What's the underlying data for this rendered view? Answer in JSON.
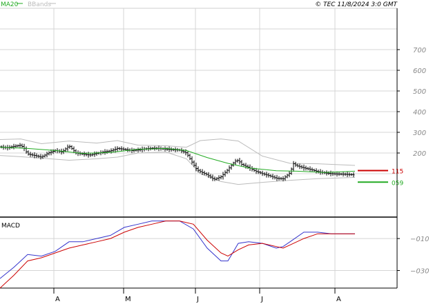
{
  "header": {
    "legend_ma": "MA20",
    "legend_bb": "BBands",
    "copyright": "© TEC 11/8/2024 3:0 GMT"
  },
  "colors": {
    "ma": "#22aa22",
    "bbands": "#bbbbbb",
    "candle": "#000000",
    "grid": "#d4d4d4",
    "axis": "#000000",
    "right_ticks": "#555555",
    "marker_red": "#cc0000",
    "marker_green": "#22aa22",
    "macd": "#3333cc",
    "signal": "#cc0000",
    "label_text": "#888888"
  },
  "price_panel": {
    "ylim": [
      -110,
      900
    ],
    "yticks": [
      {
        "value": 700,
        "label": "700"
      },
      {
        "value": 600,
        "label": "600"
      },
      {
        "value": 500,
        "label": "500"
      },
      {
        "value": 400,
        "label": "400"
      },
      {
        "value": 300,
        "label": "300"
      },
      {
        "value": 200,
        "label": "200"
      }
    ],
    "markers": [
      {
        "value": 115,
        "label": "115",
        "color": "#cc0000"
      },
      {
        "value": 59,
        "label": "059",
        "color": "#22aa22"
      }
    ]
  },
  "macd_panel": {
    "title": "MACD",
    "ylim": [
      -41,
      3
    ],
    "yticks": [
      {
        "value": -10,
        "label": "−010"
      },
      {
        "value": -30,
        "label": "−030"
      }
    ]
  },
  "x_axis": {
    "labels": [
      {
        "x": 80,
        "label": "A"
      },
      {
        "x": 181,
        "label": "M"
      },
      {
        "x": 285,
        "label": "J"
      },
      {
        "x": 378,
        "label": "J"
      },
      {
        "x": 487,
        "label": "A"
      }
    ]
  },
  "chart_data": {
    "type": "line",
    "series": [
      {
        "name": "MA20",
        "x": [
          0,
          40,
          80,
          120,
          160,
          200,
          240,
          270,
          300,
          330,
          360,
          400,
          430,
          470,
          514
        ],
        "values": [
          228,
          222,
          212,
          198,
          203,
          218,
          222,
          212,
          178,
          150,
          128,
          114,
          112,
          106,
          112
        ]
      },
      {
        "name": "BBands upper",
        "x": [
          0,
          30,
          60,
          100,
          140,
          170,
          200,
          240,
          270,
          290,
          320,
          345,
          380,
          420,
          460,
          514
        ],
        "values": [
          265,
          268,
          245,
          258,
          248,
          260,
          238,
          235,
          228,
          260,
          268,
          258,
          185,
          150,
          148,
          140
        ]
      },
      {
        "name": "BBands lower",
        "x": [
          0,
          30,
          60,
          100,
          140,
          170,
          200,
          240,
          270,
          290,
          320,
          345,
          380,
          420,
          460,
          514
        ],
        "values": [
          188,
          182,
          175,
          165,
          172,
          180,
          200,
          205,
          172,
          100,
          62,
          48,
          58,
          68,
          76,
          82
        ]
      },
      {
        "name": "Close",
        "x": [
          0,
          10,
          20,
          30,
          35,
          40,
          50,
          60,
          70,
          80,
          90,
          100,
          110,
          120,
          130,
          140,
          150,
          160,
          170,
          180,
          190,
          200,
          210,
          220,
          230,
          240,
          250,
          260,
          270,
          280,
          285,
          290,
          300,
          310,
          320,
          330,
          340,
          345,
          350,
          360,
          370,
          380,
          390,
          400,
          410,
          420,
          425,
          430,
          440,
          450,
          460,
          470,
          480,
          490,
          500,
          510,
          514
        ],
        "values": [
          230,
          225,
          232,
          238,
          222,
          195,
          188,
          180,
          200,
          212,
          205,
          235,
          200,
          195,
          190,
          198,
          205,
          210,
          222,
          218,
          212,
          215,
          220,
          223,
          222,
          219,
          216,
          214,
          200,
          145,
          120,
          110,
          95,
          72,
          85,
          120,
          160,
          165,
          145,
          130,
          112,
          100,
          90,
          78,
          75,
          105,
          148,
          138,
          128,
          120,
          110,
          104,
          100,
          98,
          97,
          95,
          94
        ]
      },
      {
        "name": "MACD",
        "x": [
          0,
          20,
          40,
          60,
          80,
          100,
          120,
          140,
          160,
          180,
          200,
          220,
          240,
          260,
          280,
          300,
          320,
          330,
          345,
          360,
          380,
          400,
          410,
          420,
          440,
          460,
          480,
          514
        ],
        "values": [
          -35,
          -28,
          -20,
          -21,
          -18,
          -12,
          -12,
          -10,
          -8,
          -3,
          -1,
          1,
          1,
          1,
          -4,
          -16,
          -24,
          -24,
          -13,
          -12,
          -13,
          -16,
          -15,
          -12,
          -6,
          -6,
          -7,
          -7
        ]
      },
      {
        "name": "Signal",
        "x": [
          0,
          20,
          40,
          60,
          80,
          100,
          120,
          140,
          160,
          180,
          200,
          220,
          240,
          260,
          280,
          300,
          320,
          330,
          345,
          360,
          380,
          400,
          410,
          420,
          440,
          460,
          480,
          514
        ],
        "values": [
          -41,
          -33,
          -24,
          -22,
          -19,
          -16,
          -14,
          -12,
          -10,
          -6,
          -3,
          -1,
          1,
          1,
          -1,
          -11,
          -19,
          -21,
          -17,
          -14,
          -13,
          -15,
          -16,
          -14,
          -10,
          -7,
          -7,
          -7
        ]
      }
    ],
    "title": "",
    "xlabel": "",
    "ylabel": ""
  }
}
